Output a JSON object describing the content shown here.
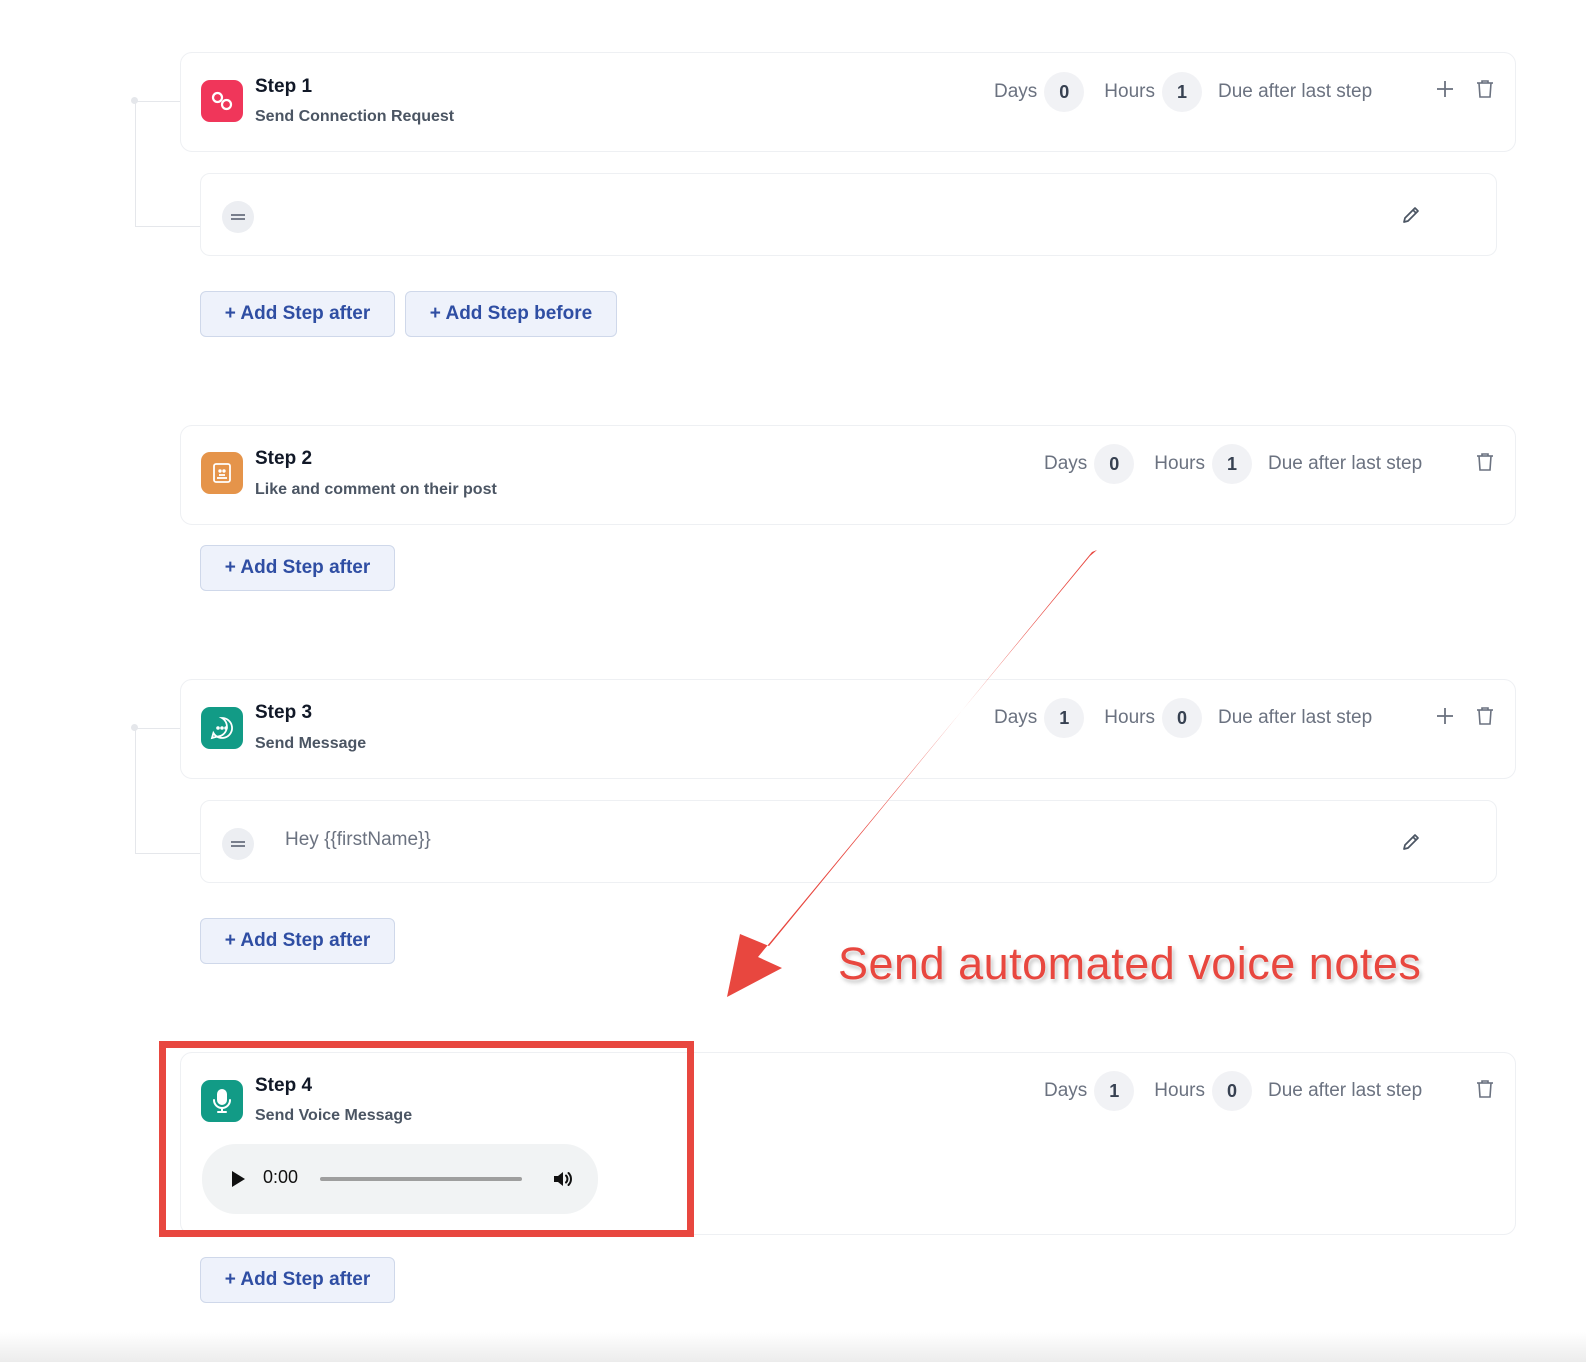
{
  "steps": [
    {
      "title": "Step 1",
      "subtitle": "Send Connection Request",
      "days_label": "Days",
      "days": "0",
      "hours_label": "Hours",
      "hours": "1",
      "due_label": "Due after last step",
      "icon": "link-icon",
      "icon_color": "#f0365a"
    },
    {
      "title": "Step 2",
      "subtitle": "Like and comment on their post",
      "days_label": "Days",
      "days": "0",
      "hours_label": "Hours",
      "hours": "1",
      "due_label": "Due after last step",
      "icon": "post-icon",
      "icon_color": "#e5944a"
    },
    {
      "title": "Step 3",
      "subtitle": "Send Message",
      "days_label": "Days",
      "days": "1",
      "hours_label": "Hours",
      "hours": "0",
      "due_label": "Due after last step",
      "icon": "chat-bubble-icon",
      "icon_color": "#129b86",
      "message": "Hey {{firstName}}"
    },
    {
      "title": "Step 4",
      "subtitle": "Send Voice Message",
      "days_label": "Days",
      "days": "1",
      "hours_label": "Hours",
      "hours": "0",
      "due_label": "Due after last step",
      "icon": "microphone-icon",
      "icon_color": "#129b86",
      "audio_time": "0:00"
    }
  ],
  "buttons": {
    "add_after": "+ Add Step after",
    "add_before": "+ Add Step before"
  },
  "annotation": {
    "text": "Send automated voice notes",
    "color": "#e8473f"
  }
}
